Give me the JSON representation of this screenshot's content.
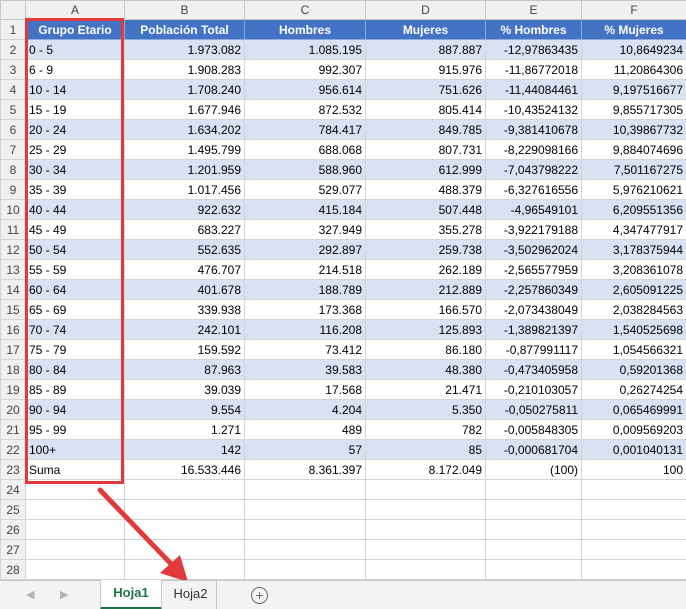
{
  "columns": [
    "A",
    "B",
    "C",
    "D",
    "E",
    "F"
  ],
  "header": {
    "row": "1",
    "cells": [
      "Grupo Etario",
      "Población Total",
      "Hombres",
      "Mujeres",
      "% Hombres",
      "% Mujeres"
    ]
  },
  "rows": [
    {
      "n": "2",
      "a": "0 - 5",
      "b": "1.973.082",
      "c": "1.085.195",
      "d": "887.887",
      "e": "-12,97863435",
      "f": "10,8649234"
    },
    {
      "n": "3",
      "a": "6 - 9",
      "b": "1.908.283",
      "c": "992.307",
      "d": "915.976",
      "e": "-11,86772018",
      "f": "11,20864306"
    },
    {
      "n": "4",
      "a": "10 - 14",
      "b": "1.708.240",
      "c": "956.614",
      "d": "751.626",
      "e": "-11,44084461",
      "f": "9,197516677"
    },
    {
      "n": "5",
      "a": "15 - 19",
      "b": "1.677.946",
      "c": "872.532",
      "d": "805.414",
      "e": "-10,43524132",
      "f": "9,855717305"
    },
    {
      "n": "6",
      "a": "20 - 24",
      "b": "1.634.202",
      "c": "784.417",
      "d": "849.785",
      "e": "-9,381410678",
      "f": "10,39867732"
    },
    {
      "n": "7",
      "a": "25 - 29",
      "b": "1.495.799",
      "c": "688.068",
      "d": "807.731",
      "e": "-8,229098166",
      "f": "9,884074696"
    },
    {
      "n": "8",
      "a": "30 - 34",
      "b": "1.201.959",
      "c": "588.960",
      "d": "612.999",
      "e": "-7,043798222",
      "f": "7,501167275"
    },
    {
      "n": "9",
      "a": "35 - 39",
      "b": "1.017.456",
      "c": "529.077",
      "d": "488.379",
      "e": "-6,327616556",
      "f": "5,976210621"
    },
    {
      "n": "10",
      "a": "40 - 44",
      "b": "922.632",
      "c": "415.184",
      "d": "507.448",
      "e": "-4,96549101",
      "f": "6,209551356"
    },
    {
      "n": "11",
      "a": "45 - 49",
      "b": "683.227",
      "c": "327.949",
      "d": "355.278",
      "e": "-3,922179188",
      "f": "4,347477917"
    },
    {
      "n": "12",
      "a": "50 - 54",
      "b": "552.635",
      "c": "292.897",
      "d": "259.738",
      "e": "-3,502962024",
      "f": "3,178375944"
    },
    {
      "n": "13",
      "a": "55 - 59",
      "b": "476.707",
      "c": "214.518",
      "d": "262.189",
      "e": "-2,565577959",
      "f": "3,208361078"
    },
    {
      "n": "14",
      "a": "60 - 64",
      "b": "401.678",
      "c": "188.789",
      "d": "212.889",
      "e": "-2,257860349",
      "f": "2,605091225"
    },
    {
      "n": "15",
      "a": "65 - 69",
      "b": "339.938",
      "c": "173.368",
      "d": "166.570",
      "e": "-2,073438049",
      "f": "2,038284563"
    },
    {
      "n": "16",
      "a": "70 - 74",
      "b": "242.101",
      "c": "116.208",
      "d": "125.893",
      "e": "-1,389821397",
      "f": "1,540525698"
    },
    {
      "n": "17",
      "a": "75 - 79",
      "b": "159.592",
      "c": "73.412",
      "d": "86.180",
      "e": "-0,877991117",
      "f": "1,054566321"
    },
    {
      "n": "18",
      "a": "80 - 84",
      "b": "87.963",
      "c": "39.583",
      "d": "48.380",
      "e": "-0,473405958",
      "f": "0,59201368"
    },
    {
      "n": "19",
      "a": "85 - 89",
      "b": "39.039",
      "c": "17.568",
      "d": "21.471",
      "e": "-0,210103057",
      "f": "0,26274254"
    },
    {
      "n": "20",
      "a": "90 - 94",
      "b": "9.554",
      "c": "4.204",
      "d": "5.350",
      "e": "-0,050275811",
      "f": "0,065469991"
    },
    {
      "n": "21",
      "a": "95 - 99",
      "b": "1.271",
      "c": "489",
      "d": "782",
      "e": "-0,005848305",
      "f": "0,009569203"
    },
    {
      "n": "22",
      "a": "100+",
      "b": "142",
      "c": "57",
      "d": "85",
      "e": "-0,000681704",
      "f": "0,001040131"
    }
  ],
  "sum_row": {
    "n": "23",
    "a": "Suma",
    "b": "16.533.446",
    "c": "8.361.397",
    "d": "8.172.049",
    "e": "(100)",
    "f": "100"
  },
  "empty_rows": [
    "24",
    "25",
    "26",
    "27",
    "28"
  ],
  "tabs": {
    "active": "Hoja1",
    "inactive": "Hoja2",
    "prev_icon": "◀",
    "next_icon": "▶",
    "add_icon": "+"
  },
  "colors": {
    "header_fill": "#4472c4",
    "band_fill": "#d9e1f2",
    "highlight": "#e03a3a",
    "active_tab": "#217346"
  }
}
